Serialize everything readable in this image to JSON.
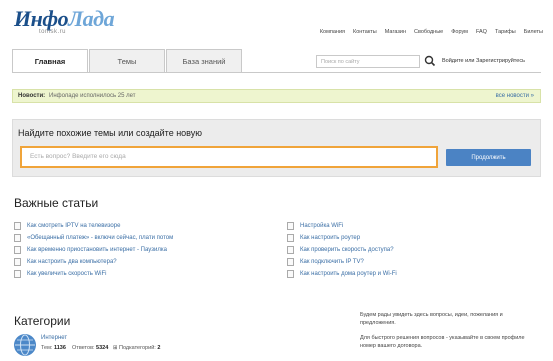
{
  "header": {
    "logo_main": "Инфо",
    "logo_alt": "Лада",
    "logo_sub": "tomsk.ru",
    "nav": [
      "Компания",
      "Контакты",
      "Магазин",
      "Свободные",
      "Форум",
      "FAQ",
      "Тарифы",
      "Билеты"
    ]
  },
  "tabs": [
    {
      "label": "Главная",
      "active": true
    },
    {
      "label": "Темы",
      "active": false
    },
    {
      "label": "База знаний",
      "active": false
    }
  ],
  "search": {
    "placeholder": "Поиск по сайту"
  },
  "login": {
    "label": "Войдите или Зарегистрируйтесь"
  },
  "news": {
    "label": "Новости:",
    "text": "Инфоладе исполнилось 25 лет",
    "all_link": "все новости »"
  },
  "question": {
    "title": "Найдите похожие темы или создайте новую",
    "placeholder": "Есть вопрос? Введите его сюда",
    "button": "Продолжить"
  },
  "articles": {
    "title": "Важные статьи",
    "left": [
      "Как смотреть IPTV на телевизоре",
      "«Обещанный платеж» - включи сейчас, плати потом",
      "Как временно приостановить интернет - Паузилка",
      "Как настроить два компьютера?",
      "Как увеличить скорость WiFi"
    ],
    "right": [
      "Настройка WiFi",
      "Как настроить роутер",
      "Как проверить скорость доступа?",
      "Как подключить IP TV?",
      "Как настроить дома роутер и Wi-Fi"
    ]
  },
  "categories": {
    "title": "Категории",
    "items": [
      {
        "name": "Интернет",
        "topics_label": "Тем:",
        "topics": "1136",
        "answers_label": "Ответов:",
        "answers": "5324",
        "sub_label": "Подкатегорий:",
        "sub": "2"
      }
    ]
  },
  "sidebar_text": {
    "p1": "Будем рады увидеть здесь вопросы, идеи, пожелания и предложения.",
    "p2": "Для быстрого решения вопросов - указывайте в своем профиле номер вашего договора."
  },
  "colors": {
    "accent": "#4b83c4",
    "input_border": "#f0a43a",
    "news_bg": "#eef5cf"
  }
}
